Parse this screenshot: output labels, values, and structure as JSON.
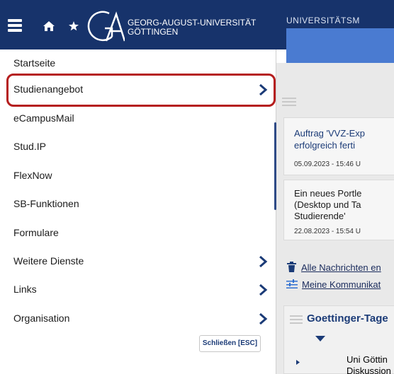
{
  "header": {
    "logo_line1": "GEORG-AUGUST-UNIVERSITÄT",
    "logo_line2": "GÖTTINGEN",
    "background_title": "UNIVERSITÄTSM",
    "brand_color": "#17336b"
  },
  "menu": {
    "items": [
      {
        "label": "Startseite",
        "has_submenu": false
      },
      {
        "label": "Studienangebot",
        "has_submenu": true
      },
      {
        "label": "eCampusMail",
        "has_submenu": false
      },
      {
        "label": "Stud.IP",
        "has_submenu": false
      },
      {
        "label": "FlexNow",
        "has_submenu": false
      },
      {
        "label": "SB-Funktionen",
        "has_submenu": false
      },
      {
        "label": "Formulare",
        "has_submenu": false
      },
      {
        "label": "Weitere Dienste",
        "has_submenu": true
      },
      {
        "label": "Links",
        "has_submenu": true
      },
      {
        "label": "Organisation",
        "has_submenu": true
      }
    ],
    "close_label": "Schließen [ESC]",
    "highlight_color": "#b51d1d"
  },
  "background": {
    "news": [
      {
        "title_line1": "Auftrag 'VVZ-Exp",
        "title_line2": "erfolgreich ferti",
        "date": "05.09.2023 - 15:46 U"
      },
      {
        "title_line1": "Ein neues Portle",
        "title_line2": "(Desktop und Ta",
        "title_line3": "Studierende'",
        "date": "22.08.2023 - 15:54 U"
      }
    ],
    "links": {
      "all_news": "Alle Nachrichten en",
      "my_comm": "Meine Kommunikat"
    },
    "section": {
      "title": "Goettinger-Tage",
      "item_line1": "Uni Göttin",
      "item_line2": "Diskussion"
    }
  }
}
